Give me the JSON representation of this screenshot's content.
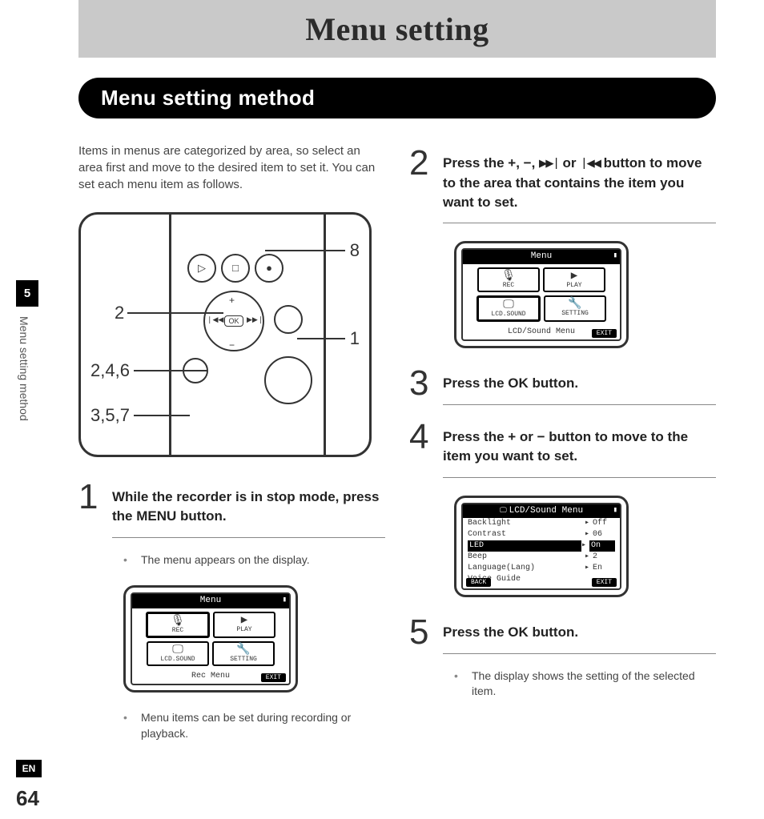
{
  "header": {
    "title": "Menu setting"
  },
  "section": {
    "title": "Menu setting method"
  },
  "sidebar": {
    "chapter": "5",
    "label": "Menu setting method",
    "lang": "EN",
    "page": "64"
  },
  "left": {
    "intro": "Items in menus are categorized by area, so select an area first and move to the desired item to set it. You can set each menu item as follows.",
    "diagram_labels": {
      "a": "8",
      "b": "2",
      "c": "1",
      "d": "2,4,6",
      "e": "3,5,7"
    },
    "step1": {
      "num": "1",
      "text_before": "While the recorder is in stop mode, press the ",
      "bold": "MENU",
      "text_after": " button.",
      "bullet_a": "The menu appears on the display.",
      "bullet_b": "Menu items can be set during recording or playback."
    },
    "lcd_rec": {
      "title": "Menu",
      "battery_icon": "▮",
      "rec": "REC",
      "play": "PLAY",
      "lcd": "LCD.SOUND",
      "setting": "SETTING",
      "footer": "Rec Menu",
      "exit": "EXIT"
    }
  },
  "right": {
    "step2": {
      "num": "2",
      "t1": "Press the ",
      "sym_plus": "+",
      "sep1": ", ",
      "sym_minus": "−",
      "sep2": ", ",
      "icon_ff": "▶▶❘",
      "sep3": " or ",
      "icon_rw": "❘◀◀",
      "t2": " button to move to the area that contains the item you want to set."
    },
    "lcd_menu": {
      "title": "Menu",
      "battery_icon": "▮",
      "rec": "REC",
      "play": "PLAY",
      "lcd": "LCD.SOUND",
      "setting": "SETTING",
      "footer": "LCD/Sound Menu",
      "exit": "EXIT"
    },
    "step3": {
      "num": "3",
      "t1": "Press the ",
      "bold": "OK",
      "t2": " button."
    },
    "step4": {
      "num": "4",
      "text": "Press the + or − button to move to the item you want to set."
    },
    "lcd_list": {
      "title": "LCD/Sound Menu",
      "battery_icon": "▮",
      "rows": [
        {
          "k": "Backlight",
          "v": "Off"
        },
        {
          "k": "Contrast",
          "v": "06"
        },
        {
          "k": "LED",
          "v": "On",
          "sel": true
        },
        {
          "k": "Beep",
          "v": "2"
        },
        {
          "k": "Language(Lang)",
          "v": "En"
        },
        {
          "k": "Voice Guide",
          "v": ""
        }
      ],
      "back": "BACK",
      "exit": "EXIT"
    },
    "step5": {
      "num": "5",
      "t1": "Press the ",
      "bold": "OK",
      "t2": " button.",
      "bullet": "The display shows the setting of the selected item."
    }
  }
}
